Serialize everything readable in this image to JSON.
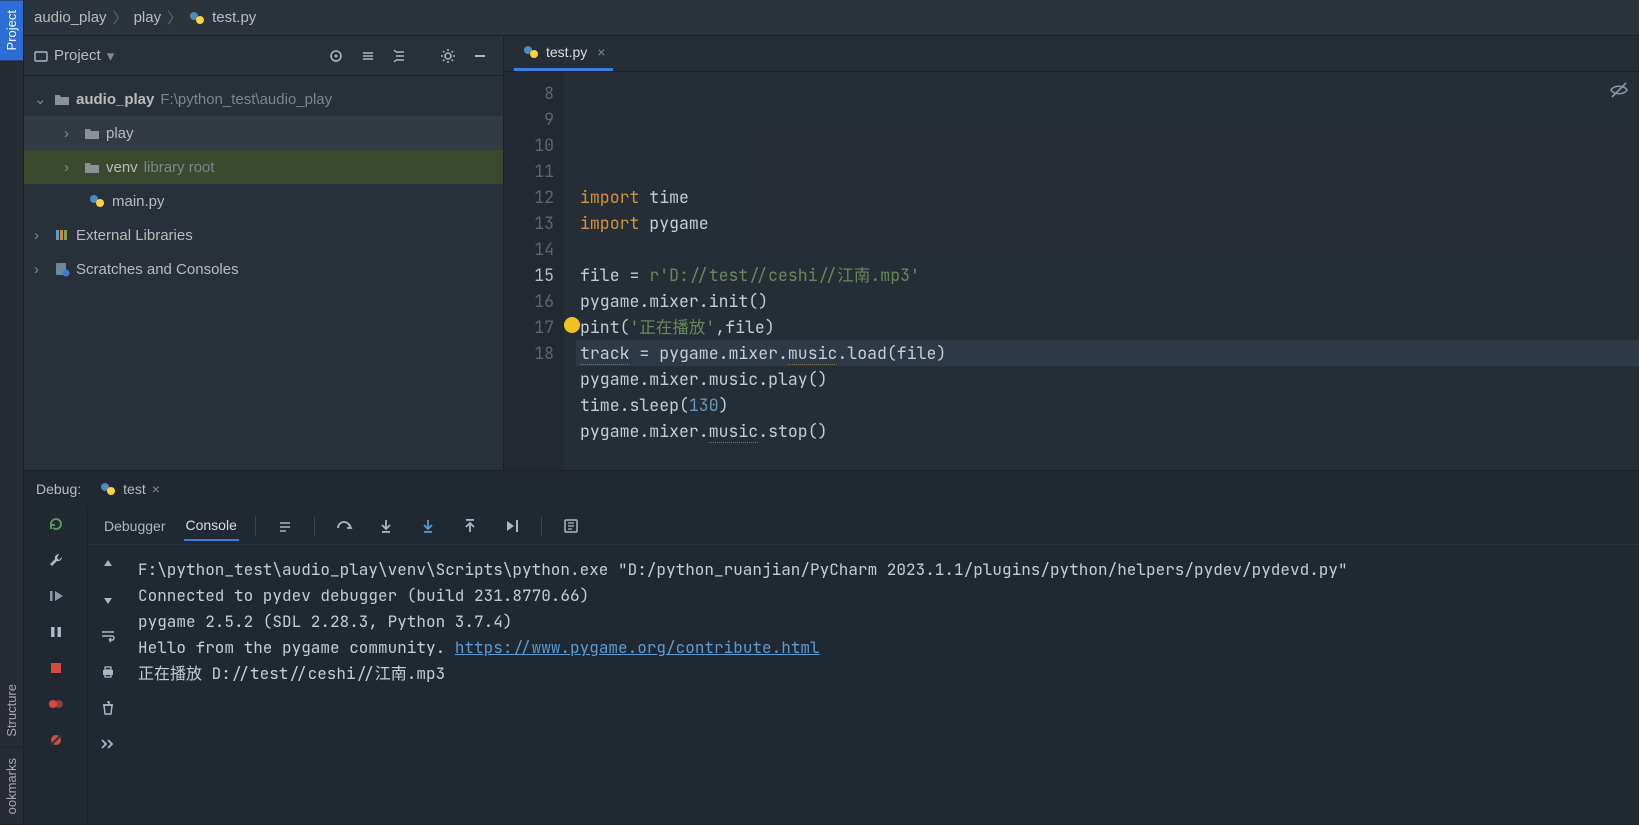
{
  "breadcrumb": [
    "audio_play",
    "play",
    "test.py"
  ],
  "leftRail": {
    "project": "Project",
    "structure": "Structure",
    "bookmarks": "ookmarks"
  },
  "projectPanel": {
    "title": "Project",
    "tree": {
      "root": {
        "name": "audio_play",
        "path": "F:\\python_test\\audio_play"
      },
      "play": "play",
      "venv": "venv",
      "venvTag": "library root",
      "main": "main.py",
      "ext": "External Libraries",
      "scratch": "Scratches and Consoles"
    }
  },
  "editor": {
    "tab": "test.py",
    "startLine": 8,
    "currentLine": 15,
    "lines": [
      {
        "n": 8,
        "html": ""
      },
      {
        "n": 9,
        "html": "<span class='k'>import</span> time"
      },
      {
        "n": 10,
        "html": "<span class='k'>import</span> pygame"
      },
      {
        "n": 11,
        "html": ""
      },
      {
        "n": 12,
        "html": "file = <span class='s'>r'D://test//ceshi//江南.mp3'</span>"
      },
      {
        "n": 13,
        "html": "pygame.mixer.init()"
      },
      {
        "n": 14,
        "html": "p<span class='bulb'></span>int(<span class='s'>'正在播放'</span>,file)"
      },
      {
        "n": 15,
        "html": "<span class='w'>track</span> = pygame.mixer.<span class='w'>music</span>.load(file)"
      },
      {
        "n": 16,
        "html": "pygame.mixer.music.play()"
      },
      {
        "n": 17,
        "html": "time.sleep(<span class='n'>130</span>)"
      },
      {
        "n": 18,
        "html": "pygame.mixer.<span class='w'>music</span>.stop()"
      }
    ]
  },
  "debug": {
    "label": "Debug:",
    "runConfig": "test",
    "tabs": {
      "debugger": "Debugger",
      "console": "Console"
    },
    "console": [
      {
        "t": "F:\\python_test\\audio_play\\venv\\Scripts\\python.exe \"D:/python_ruanjian/PyCharm 2023.1.1/plugins/python/helpers/pydev/pydevd.py\""
      },
      {
        "t": "Connected to pydev debugger (build 231.8770.66)"
      },
      {
        "t": "pygame 2.5.2 (SDL 2.28.3, Python 3.7.4)"
      },
      {
        "t": "Hello from the pygame community. ",
        "link": "https://www.pygame.org/contribute.html"
      },
      {
        "t": "正在播放 D://test//ceshi//江南.mp3"
      }
    ]
  }
}
